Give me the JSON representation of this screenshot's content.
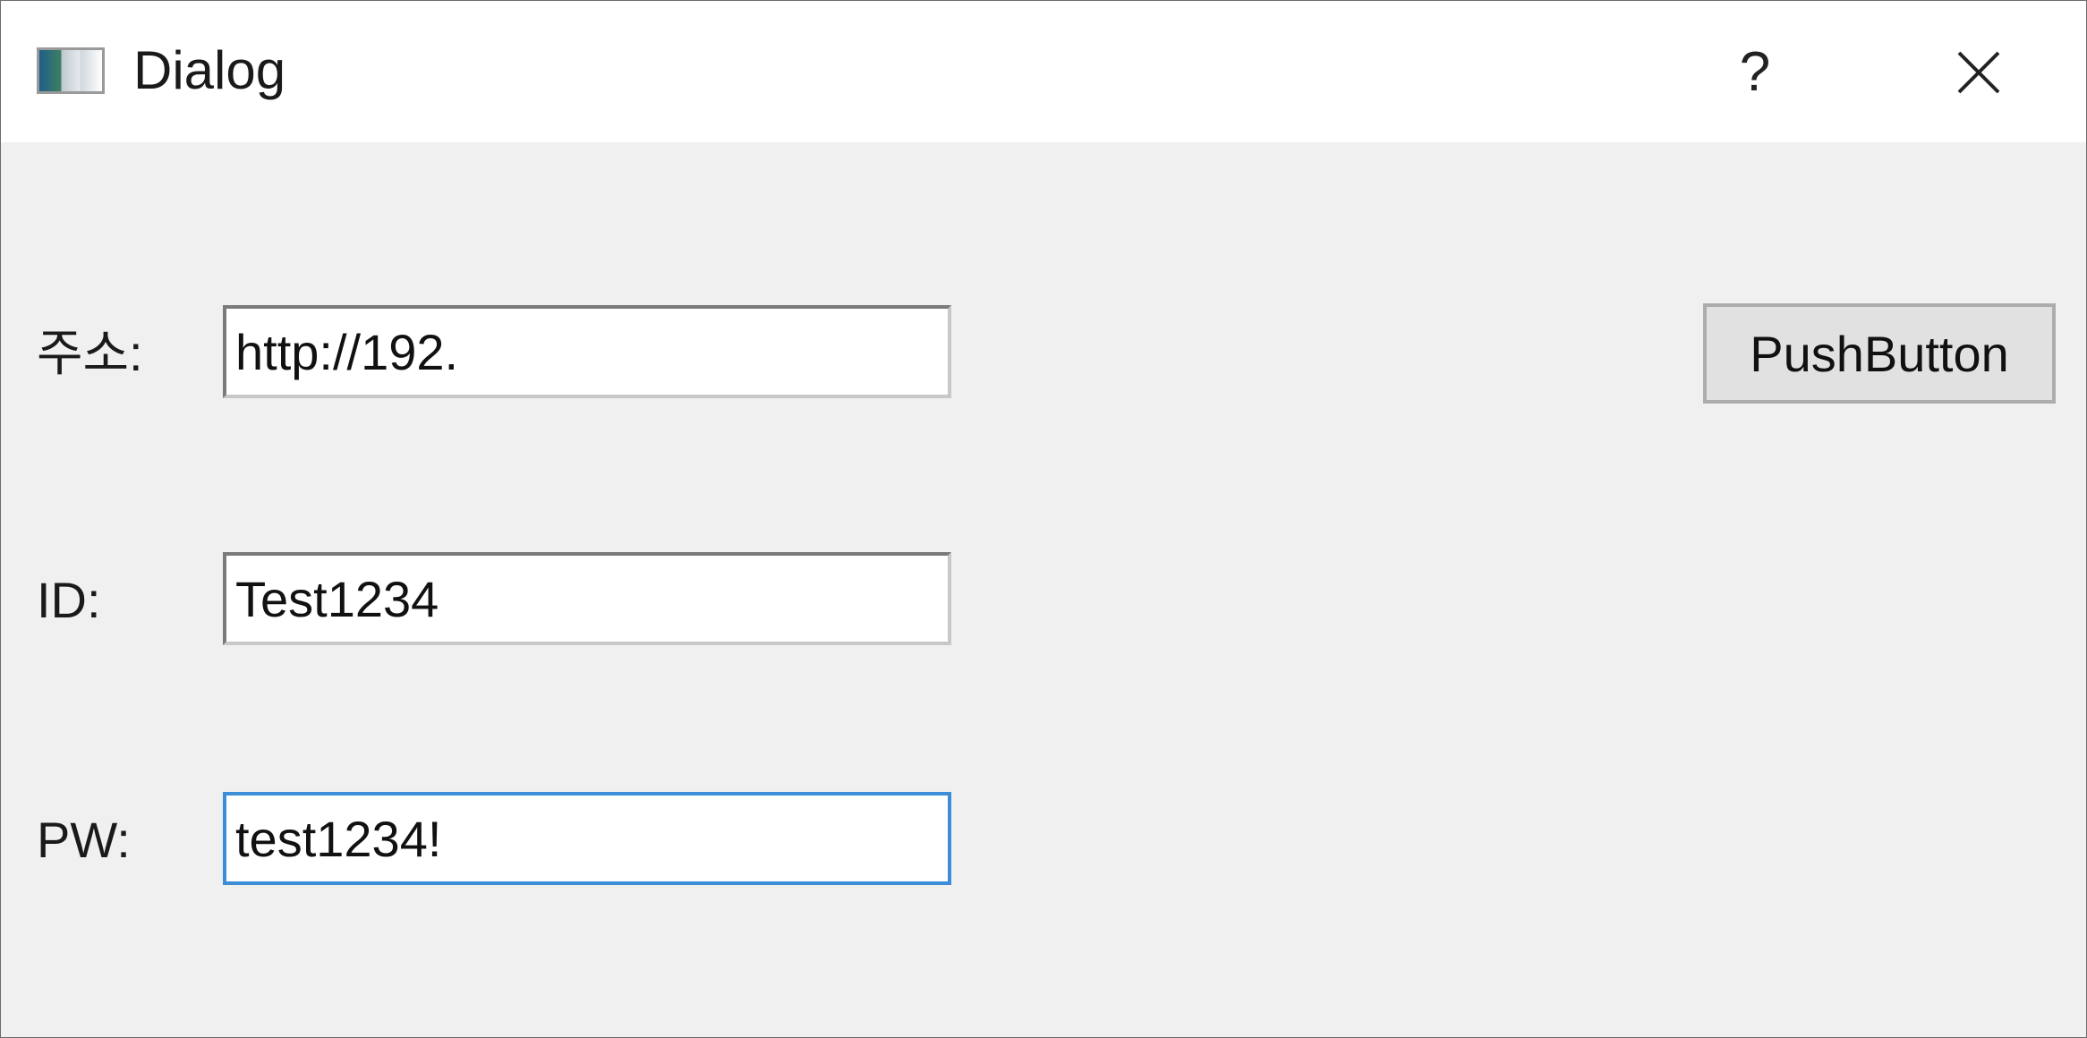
{
  "window": {
    "title": "Dialog",
    "help_label": "?"
  },
  "form": {
    "address": {
      "label": "주소:",
      "value": "http://192."
    },
    "id": {
      "label": "ID:",
      "value": "Test1234"
    },
    "pw": {
      "label": "PW:",
      "value": "test1234!"
    }
  },
  "actions": {
    "push_button_label": "PushButton"
  },
  "icons": {
    "app": "app-window-icon",
    "close": "close-icon"
  },
  "colors": {
    "focus_border": "#3c8ed8",
    "client_background": "#f0f0f0"
  }
}
